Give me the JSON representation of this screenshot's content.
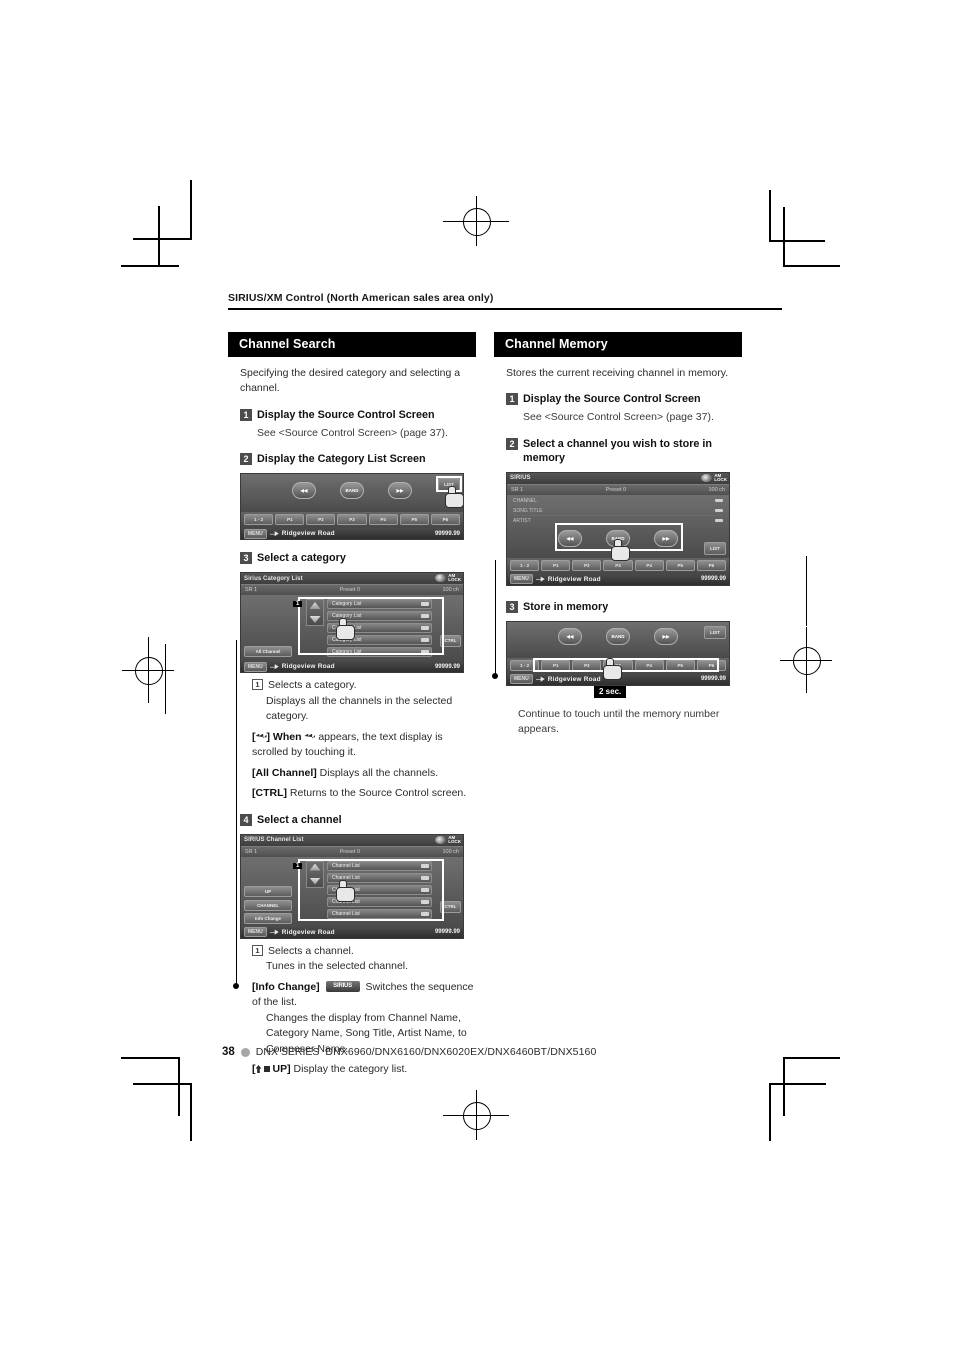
{
  "breadcrumb": "SIRIUS/XM Control (North American sales area only)",
  "left_column": {
    "section_title": "Channel Search",
    "intro": "Specifying the desired category and selecting a channel.",
    "steps": [
      {
        "num": "1",
        "title": "Display the Source Control Screen",
        "sub": "See <Source Control Screen> (page 37)."
      },
      {
        "num": "2",
        "title": "Display the Category List Screen"
      },
      {
        "num": "3",
        "title": "Select a category"
      },
      {
        "num": "4",
        "title": "Select a channel"
      }
    ],
    "category_notes": {
      "n1_box": "1",
      "n1_line1": "Selects a category.",
      "n1_line2": "Displays all the channels in the selected category.",
      "scroll_label": "[",
      "scroll_text": "] When",
      "scroll_text2": "appears, the text display is scrolled by touching it.",
      "all_channel_key": "[All Channel]",
      "all_channel_desc": "Displays all the channels.",
      "ctrl_key": "[CTRL]",
      "ctrl_desc": "Returns to the Source Control screen."
    },
    "channel_notes": {
      "n1_box": "1",
      "n1_line1": "Selects a channel.",
      "n1_line2": "Tunes in the selected channel.",
      "info_key": "[Info Change]",
      "info_chip": "SIRIUS",
      "info_desc": "Switches the sequence of the list.",
      "info_desc2": "Changes the display from Channel Name, Category Name, Song Title, Artist Name, to Composer Name.",
      "up_key": "UP]",
      "up_desc": "Display the category list."
    }
  },
  "right_column": {
    "section_title": "Channel Memory",
    "intro": "Stores the current receiving channel in memory.",
    "steps": [
      {
        "num": "1",
        "title": "Display the Source Control Screen",
        "sub": "See <Source Control Screen> (page 37)."
      },
      {
        "num": "2",
        "title": "Select a channel you wish to store in memory"
      },
      {
        "num": "3",
        "title": "Store in memory"
      }
    ],
    "hold_badge": "2 sec.",
    "hold_note": "Continue to touch until the memory number appears."
  },
  "devices": {
    "source_control": {
      "list_button": "LIST",
      "presets": [
        "1 - 2",
        "P1",
        "P2",
        "P3",
        "P4",
        "P5",
        "P6"
      ],
      "menu_button": "MENU",
      "song": "Ridgeview Road",
      "freq": "99999.99"
    },
    "category_list": {
      "title": "Sirius Category List",
      "band": "SR 1",
      "preset": "Preset  0",
      "channels": "100  ch",
      "rows": [
        "Category List",
        "Category List",
        "Category List",
        "Category List",
        "Category List"
      ],
      "all_channel_button": "All Channel",
      "ctrl_button": "CTRL",
      "menu_button": "MENU",
      "song": "Ridgeview Road",
      "freq": "99999.99",
      "callout_num": "1"
    },
    "channel_list": {
      "title": "SIRIUS Channel List",
      "band": "SR 1",
      "preset": "Preset  0",
      "channels": "100  ch",
      "rows": [
        "Channel List",
        "Channel List",
        "Channel List",
        "Channel List",
        "Channel List"
      ],
      "up_button": "UP",
      "channel_button": "CHANNEL",
      "info_button": "Info Change",
      "ctrl_button": "CTRL",
      "menu_button": "MENU",
      "song": "Ridgeview Road",
      "freq": "99999.99",
      "callout_num": "1"
    },
    "sirius_main": {
      "title": "SIRIUS",
      "band": "SR  1",
      "preset": "Preset  0",
      "channels": "100  ch",
      "meta": [
        "CHANNEL",
        "SONG TITLE",
        "ARTIST"
      ],
      "transport": [
        "◀◀",
        "BAND",
        "▶▶"
      ],
      "list_button": "LIST",
      "presets": [
        "1 - 2",
        "P1",
        "P2",
        "P3",
        "P4",
        "P5",
        "P6"
      ],
      "menu_button": "MENU",
      "song": "Ridgeview Road",
      "freq": "99999.99"
    },
    "memory_store": {
      "transport": [
        "◀◀",
        "BAND",
        "▶▶"
      ],
      "list_button": "LIST",
      "presets": [
        "1 - 2",
        "P1",
        "P2",
        "P3",
        "P4",
        "P5",
        "P6"
      ],
      "menu_button": "MENU",
      "song": "Ridgeview Road",
      "freq": "99999.99"
    }
  },
  "footer": {
    "page": "38",
    "series": "DNX SERIES",
    "models": "DNX6960/DNX6160/DNX6020EX/DNX6460BT/DNX5160"
  }
}
